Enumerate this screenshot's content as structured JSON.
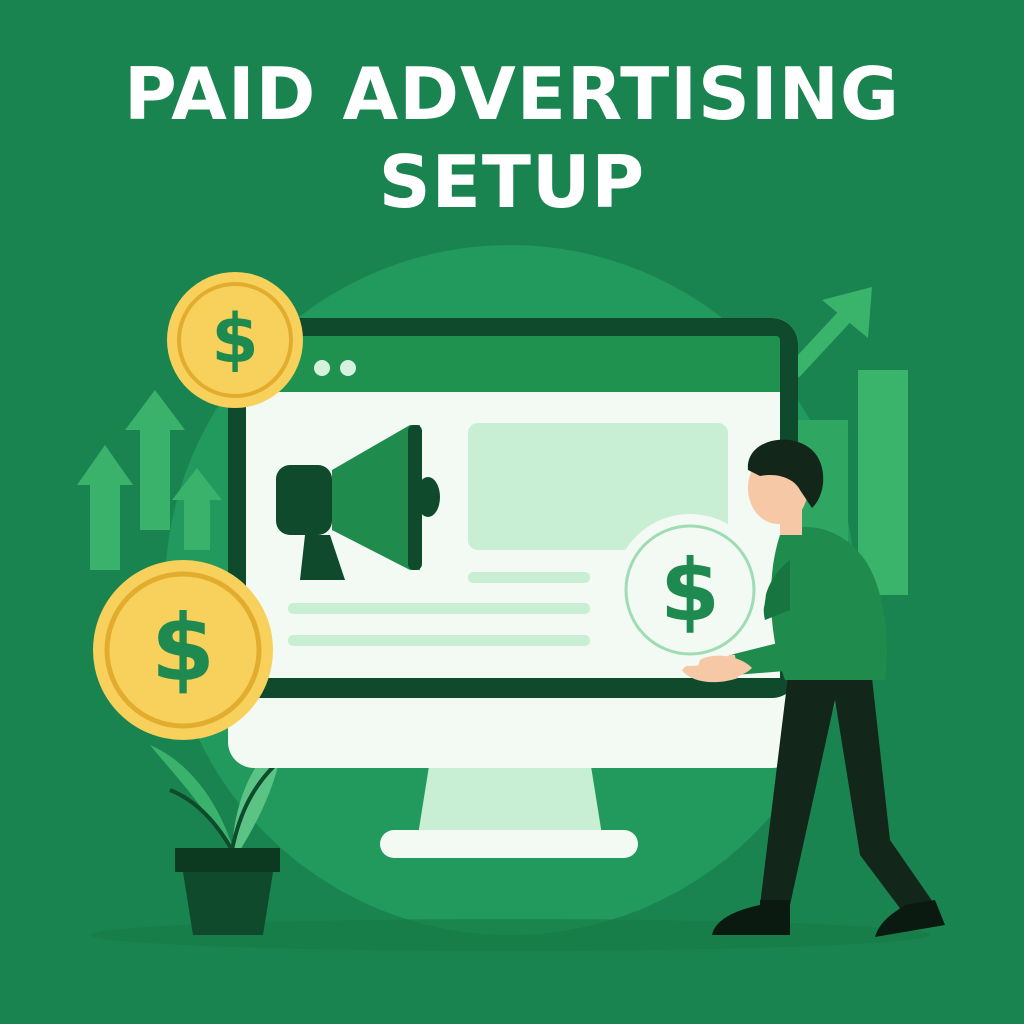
{
  "title": {
    "line1": "PAID ADVERTISING",
    "line2": "SETUP"
  },
  "coin": {
    "symbol": "$"
  },
  "colors": {
    "background": "#1a8450",
    "circle": "#249a5f",
    "monitor_frame": "#0e4a2b",
    "screen": "#f2faf3",
    "coin_gold": "#f7d15b",
    "coin_rim": "#e2ad2e",
    "coin_symbol": "#1f8a4f",
    "shirt": "#1f8c4e",
    "pants": "#13261a",
    "skin": "#f6c8a6"
  },
  "icons": [
    "megaphone-icon",
    "dollar-coin-icon",
    "arrow-up-icon",
    "growth-arrow-icon",
    "plant-icon"
  ]
}
